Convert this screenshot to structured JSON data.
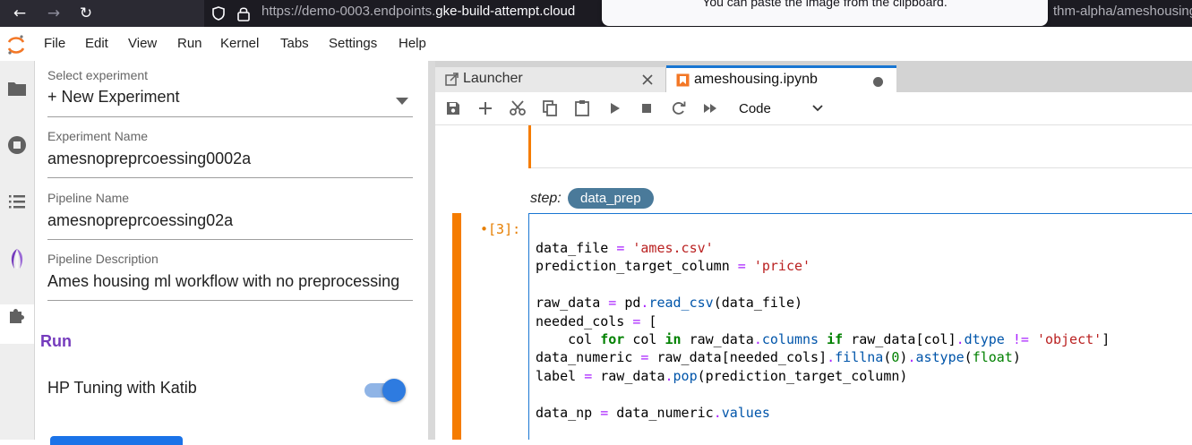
{
  "browser": {
    "url_prefix": "https://demo-0003.endpoints.",
    "url_domain": "gke-build-attempt.cloud",
    "url_suffix": "thm-alpha/ameshousing",
    "toast": "You can paste the image from the clipboard.",
    "back_icon": "←",
    "forward_icon": "→",
    "reload_icon": "↻"
  },
  "menu": [
    "File",
    "Edit",
    "View",
    "Run",
    "Kernel",
    "Tabs",
    "Settings",
    "Help"
  ],
  "kale": {
    "select_experiment_label": "Select experiment",
    "select_experiment_value": "+ New Experiment",
    "experiment_name_label": "Experiment Name",
    "experiment_name_value": "amesnopreprcoessing0002a",
    "pipeline_name_label": "Pipeline Name",
    "pipeline_name_value": "amesnopreprcoessing02a",
    "pipeline_description_label": "Pipeline Description",
    "pipeline_description_value": "Ames housing ml workflow with no preprocessing",
    "run_heading": "Run",
    "hp_tuning_label": "HP Tuning with Katib",
    "hp_tuning_enabled": true
  },
  "tabs": [
    {
      "label": "Launcher"
    },
    {
      "label": "ameshousing.ipynb"
    }
  ],
  "toolbar": {
    "cell_type": "Code"
  },
  "notebook": {
    "step_label": "step:",
    "step_name": "data_prep",
    "prompt": "•[3]:"
  },
  "colors": {
    "accent": "#1976d2",
    "cell_bar": "#f57c00",
    "kale_purple": "#753bbd",
    "step_chip": "#4a7a9a"
  }
}
